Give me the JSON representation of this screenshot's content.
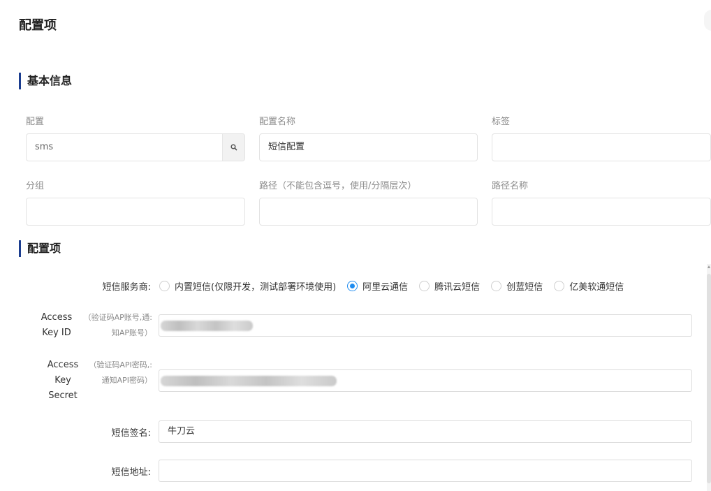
{
  "page": {
    "title": "配置项"
  },
  "basic": {
    "section_title": "基本信息",
    "config_label": "配置",
    "config_value": "sms",
    "config_name_label": "配置名称",
    "config_name_value": "短信配置",
    "tag_label": "标签",
    "tag_value": "",
    "group_label": "分组",
    "group_value": "",
    "path_label": "路径（不能包含逗号，使用/分隔层次）",
    "path_value": "",
    "path_name_label": "路径名称",
    "path_name_value": ""
  },
  "config_items": {
    "section_title": "配置项",
    "provider_label": "短信服务商:",
    "providers": [
      {
        "label": "内置短信(仅限开发，测试部署环境使用)",
        "checked": false
      },
      {
        "label": "阿里云通信",
        "checked": true
      },
      {
        "label": "腾讯云短信",
        "checked": false
      },
      {
        "label": "创蓝短信",
        "checked": false
      },
      {
        "label": "亿美软通短信",
        "checked": false
      }
    ],
    "access_key_id_line1": "Access",
    "access_key_id_line2": "Key ID",
    "access_key_id_hint_line1": "（验证码AP账号,通:",
    "access_key_id_hint_line2": "知AP账号）",
    "access_key_secret_line1": "Access",
    "access_key_secret_line2": "Key",
    "access_key_secret_line3": "Secret",
    "access_key_secret_hint_line1": "（验证码API密码,:",
    "access_key_secret_hint_line2": "通知API密码）",
    "sign_label": "短信签名:",
    "sign_value": "牛刀云",
    "address_label": "短信地址:",
    "address_value": ""
  },
  "icons": {
    "search": "search-icon"
  }
}
